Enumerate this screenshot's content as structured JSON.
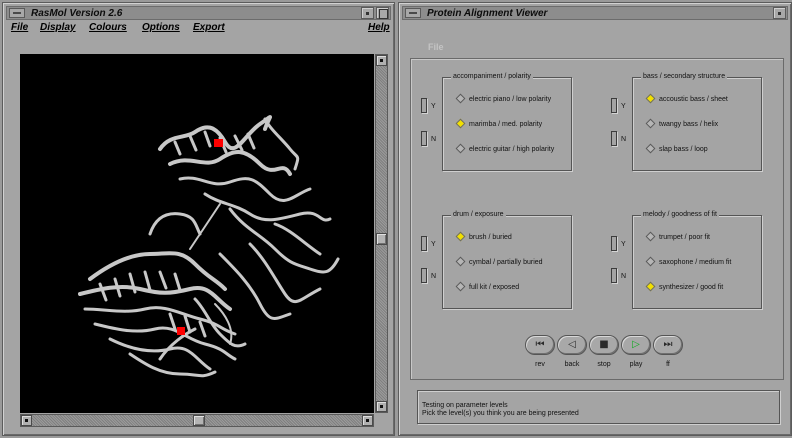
{
  "rasmol": {
    "title": "RasMol Version 2.6",
    "menu": [
      "File",
      "Display",
      "Colours",
      "Options",
      "Export"
    ],
    "help": "Help"
  },
  "viewer": {
    "title": "Protein Alignment Viewer",
    "menu_file": "File",
    "groups": [
      {
        "title": "accompaniment / polarity",
        "options": [
          {
            "label": "electric piano / low polarity",
            "selected": false
          },
          {
            "label": "marimba / med. polarity",
            "selected": true
          },
          {
            "label": "electric guitar / high polarity",
            "selected": false
          }
        ]
      },
      {
        "title": "bass / secondary structure",
        "options": [
          {
            "label": "accoustic bass / sheet",
            "selected": true
          },
          {
            "label": "twangy bass / helix",
            "selected": false
          },
          {
            "label": "slap bass / loop",
            "selected": false
          }
        ]
      },
      {
        "title": "drum / exposure",
        "options": [
          {
            "label": "brush / buried",
            "selected": true
          },
          {
            "label": "cymbal / partially buried",
            "selected": false
          },
          {
            "label": "full kit / exposed",
            "selected": false
          }
        ]
      },
      {
        "title": "melody / goodness of fit",
        "options": [
          {
            "label": "trumpet / poor fit",
            "selected": false
          },
          {
            "label": "saxophone / medium fit",
            "selected": false
          },
          {
            "label": "synthesizer / good fit",
            "selected": true
          }
        ]
      }
    ],
    "yes_label": "Y",
    "no_label": "N",
    "transport": [
      {
        "label": "rev",
        "icon": "rewind-icon",
        "glyph": "⏮"
      },
      {
        "label": "back",
        "icon": "back-icon",
        "glyph": "◁"
      },
      {
        "label": "stop",
        "icon": "stop-icon",
        "glyph": "■"
      },
      {
        "label": "play",
        "icon": "play-icon",
        "glyph": "▷"
      },
      {
        "label": "ff",
        "icon": "fast-forward-icon",
        "glyph": "⏭"
      }
    ],
    "status": [
      "Testing on parameter levels",
      "Pick the level(s) you think you are being presented"
    ]
  },
  "colors": {
    "selected_radio": "#f2e000",
    "molecule": "#c8c8c8",
    "highlight_residue": "#ff0000",
    "canvas_bg": "#000000",
    "play_icon": "#11aa22"
  }
}
